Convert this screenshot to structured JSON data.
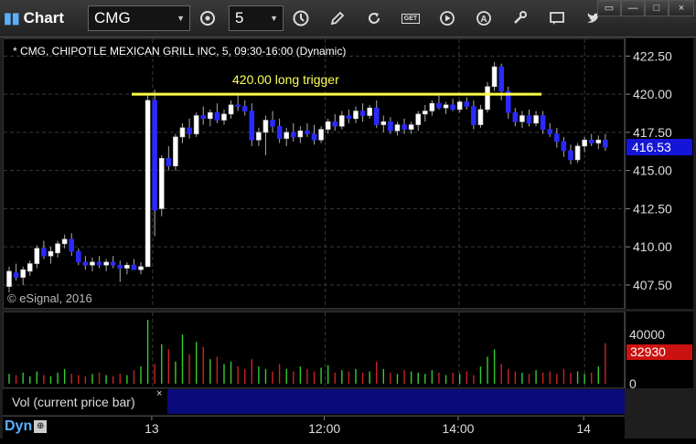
{
  "toolbar": {
    "app_label": "Chart",
    "symbol_value": "CMG",
    "interval_value": "5",
    "icons": [
      "settings-icon",
      "clock-icon",
      "pencil-icon",
      "refresh-icon",
      "get-icon",
      "play-icon",
      "alert-icon",
      "tools-icon",
      "chat-icon",
      "twitter-icon"
    ]
  },
  "window_controls": {
    "restore": "▭",
    "minimize": "—",
    "maximize": "□",
    "close": "×"
  },
  "chart": {
    "header": "* CMG, CHIPOTLE MEXICAN GRILL INC, 5, 09:30-16:00 (Dynamic)",
    "watermark": "© eSignal, 2016",
    "trigger_label": "420.00 long trigger",
    "trigger_price": 420.0,
    "current_price": "416.53",
    "current_volume": "32930",
    "colors": {
      "up": "#ffffff",
      "down": "#2a2aff",
      "trigger": "#ffff44",
      "price_tag": "#1515d8",
      "volume_tag": "#cc1111",
      "vol_up": "#33cc33",
      "vol_down": "#cc2222"
    }
  },
  "volume_panel": {
    "label": "Vol (current price bar)",
    "close": "×"
  },
  "footer": {
    "mode": "Dyn"
  },
  "chart_data": {
    "type": "candlestick",
    "title": "* CMG, CHIPOTLE MEXICAN GRILL INC, 5, 09:30-16:00 (Dynamic)",
    "price_ticks": [
      "422.50",
      "420.00",
      "417.50",
      "415.00",
      "412.50",
      "410.00",
      "407.50"
    ],
    "ylim": [
      406.0,
      423.6
    ],
    "volume_ticks": [
      "40000",
      "0"
    ],
    "volume_ylim": [
      0,
      55000
    ],
    "time_ticks": [
      "13",
      "12:00",
      "14:00",
      "14"
    ],
    "x_index_ticks": [
      20.7,
      45.6,
      64.9,
      83.0
    ],
    "bars": [
      [
        407.4,
        408.7,
        407.0,
        408.4
      ],
      [
        408.3,
        408.9,
        407.8,
        408.0
      ],
      [
        408.0,
        408.7,
        407.5,
        408.5
      ],
      [
        408.4,
        409.1,
        408.1,
        408.9
      ],
      [
        408.9,
        410.1,
        408.6,
        409.9
      ],
      [
        409.9,
        410.4,
        409.2,
        409.4
      ],
      [
        409.4,
        410.0,
        408.9,
        409.7
      ],
      [
        409.6,
        410.4,
        409.3,
        410.2
      ],
      [
        410.2,
        410.8,
        409.9,
        410.5
      ],
      [
        410.5,
        410.9,
        409.4,
        409.7
      ],
      [
        409.7,
        409.9,
        408.8,
        409.0
      ],
      [
        409.0,
        409.4,
        408.5,
        408.8
      ],
      [
        408.8,
        409.3,
        408.4,
        409.0
      ],
      [
        409.0,
        409.4,
        408.6,
        408.8
      ],
      [
        408.8,
        409.2,
        408.4,
        409.0
      ],
      [
        409.0,
        409.4,
        408.6,
        408.8
      ],
      [
        408.8,
        409.1,
        407.7,
        408.6
      ],
      [
        408.6,
        409.0,
        408.2,
        408.8
      ],
      [
        408.8,
        409.2,
        408.5,
        408.5
      ],
      [
        408.5,
        409.0,
        408.2,
        408.7
      ],
      [
        408.7,
        420.0,
        411.0,
        419.6
      ],
      [
        419.6,
        420.3,
        410.7,
        412.4
      ],
      [
        412.5,
        416.0,
        412.0,
        415.8
      ],
      [
        415.8,
        416.6,
        415.0,
        415.3
      ],
      [
        415.3,
        417.4,
        415.0,
        417.2
      ],
      [
        417.2,
        418.1,
        416.8,
        417.8
      ],
      [
        417.8,
        418.4,
        417.1,
        417.4
      ],
      [
        417.4,
        418.8,
        417.2,
        418.6
      ],
      [
        418.6,
        419.2,
        418.0,
        418.4
      ],
      [
        418.4,
        419.0,
        417.9,
        418.8
      ],
      [
        418.8,
        419.4,
        418.1,
        418.3
      ],
      [
        418.3,
        419.0,
        418.0,
        418.7
      ],
      [
        418.7,
        419.6,
        418.4,
        419.3
      ],
      [
        419.3,
        420.0,
        418.9,
        419.2
      ],
      [
        419.2,
        419.6,
        418.6,
        418.9
      ],
      [
        418.9,
        419.4,
        416.6,
        417.0
      ],
      [
        417.0,
        417.8,
        416.6,
        417.5
      ],
      [
        417.5,
        418.6,
        416.0,
        418.3
      ],
      [
        418.3,
        418.9,
        417.5,
        417.9
      ],
      [
        417.9,
        418.4,
        416.8,
        417.1
      ],
      [
        417.1,
        417.8,
        416.6,
        417.5
      ],
      [
        417.5,
        418.1,
        416.9,
        417.2
      ],
      [
        417.2,
        417.9,
        416.8,
        417.6
      ],
      [
        417.6,
        418.1,
        417.2,
        417.4
      ],
      [
        417.4,
        418.0,
        416.7,
        417.0
      ],
      [
        417.0,
        417.9,
        416.8,
        417.7
      ],
      [
        417.7,
        418.4,
        417.4,
        418.2
      ],
      [
        418.2,
        418.7,
        417.6,
        417.9
      ],
      [
        417.9,
        418.9,
        417.7,
        418.6
      ],
      [
        418.6,
        419.0,
        418.1,
        418.4
      ],
      [
        418.4,
        419.2,
        418.1,
        418.9
      ],
      [
        418.9,
        419.4,
        418.2,
        418.6
      ],
      [
        418.6,
        419.3,
        418.4,
        419.1
      ],
      [
        419.1,
        419.6,
        417.8,
        418.0
      ],
      [
        418.0,
        418.6,
        417.5,
        418.2
      ],
      [
        418.2,
        418.5,
        417.4,
        417.6
      ],
      [
        417.6,
        418.2,
        417.3,
        418.0
      ],
      [
        418.0,
        418.4,
        417.4,
        417.7
      ],
      [
        417.7,
        418.2,
        417.4,
        418.0
      ],
      [
        418.0,
        418.9,
        417.6,
        418.7
      ],
      [
        418.7,
        419.3,
        418.2,
        418.9
      ],
      [
        418.9,
        419.6,
        418.6,
        419.4
      ],
      [
        419.4,
        419.9,
        419.0,
        419.1
      ],
      [
        419.1,
        419.5,
        418.7,
        419.3
      ],
      [
        419.3,
        419.7,
        418.9,
        419.0
      ],
      [
        419.0,
        419.6,
        418.8,
        419.5
      ],
      [
        419.5,
        419.8,
        419.0,
        419.2
      ],
      [
        419.2,
        419.6,
        417.7,
        418.0
      ],
      [
        418.0,
        419.3,
        417.8,
        419.0
      ],
      [
        419.0,
        420.8,
        418.8,
        420.5
      ],
      [
        420.5,
        422.1,
        420.2,
        421.8
      ],
      [
        421.8,
        422.0,
        419.6,
        420.2
      ],
      [
        420.2,
        420.5,
        418.4,
        418.8
      ],
      [
        418.8,
        419.1,
        417.9,
        418.2
      ],
      [
        418.2,
        418.9,
        417.8,
        418.6
      ],
      [
        418.6,
        419.0,
        417.9,
        418.1
      ],
      [
        418.1,
        418.9,
        417.9,
        418.6
      ],
      [
        418.6,
        418.9,
        417.4,
        417.7
      ],
      [
        417.7,
        418.1,
        417.2,
        417.4
      ],
      [
        417.4,
        417.8,
        416.5,
        416.9
      ],
      [
        416.9,
        417.2,
        415.9,
        416.3
      ],
      [
        416.3,
        416.7,
        415.4,
        415.7
      ],
      [
        415.7,
        416.8,
        415.5,
        416.6
      ],
      [
        416.6,
        417.2,
        416.2,
        417.0
      ],
      [
        417.0,
        417.4,
        416.6,
        416.8
      ],
      [
        416.8,
        417.3,
        416.4,
        417.0
      ],
      [
        417.0,
        417.4,
        416.3,
        416.53
      ]
    ],
    "volumes": [
      8000,
      7000,
      9000,
      6000,
      10000,
      7000,
      6000,
      9000,
      12000,
      8000,
      7000,
      6000,
      8000,
      9000,
      7000,
      6000,
      8000,
      7000,
      11000,
      14000,
      52000,
      16000,
      32000,
      28000,
      18000,
      40000,
      24000,
      34000,
      30000,
      20000,
      22000,
      16000,
      18000,
      14000,
      12000,
      20000,
      14000,
      12000,
      10000,
      16000,
      12000,
      10000,
      14000,
      12000,
      10000,
      13000,
      15000,
      9000,
      11000,
      10000,
      12000,
      9000,
      10000,
      18000,
      12000,
      9000,
      8000,
      11000,
      10000,
      9000,
      8000,
      11000,
      9000,
      7000,
      9000,
      8000,
      10000,
      7000,
      14000,
      22000,
      28000,
      16000,
      12000,
      10000,
      9000,
      8000,
      11000,
      9000,
      10000,
      8000,
      12000,
      9000,
      10000,
      8000,
      9000,
      14000,
      32930
    ]
  }
}
